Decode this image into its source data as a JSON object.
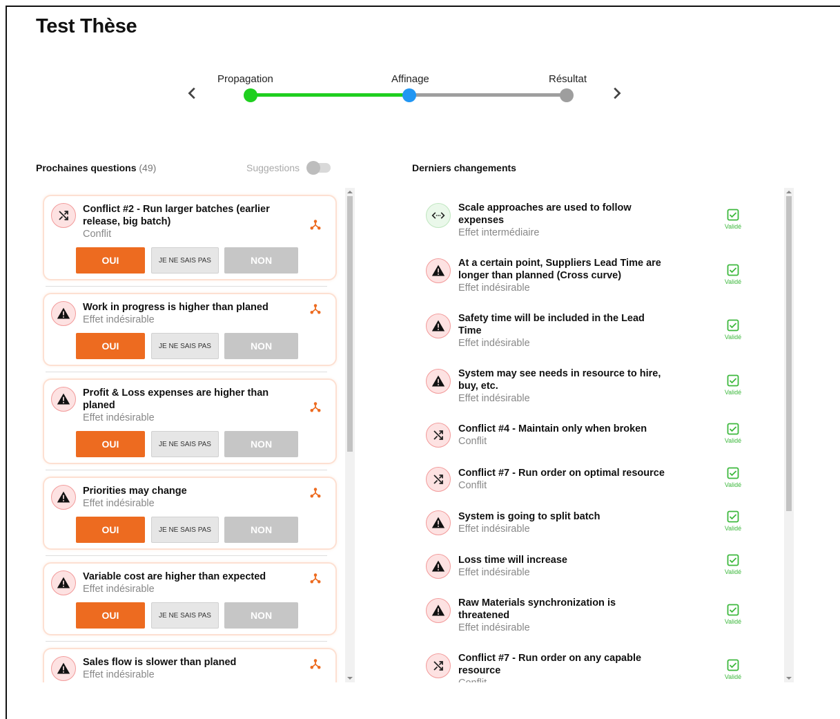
{
  "page": {
    "title": "Test Thèse"
  },
  "stepper": {
    "steps": [
      {
        "label": "Propagation",
        "state": "done",
        "color": "#1fcf1f"
      },
      {
        "label": "Affinage",
        "state": "current",
        "color": "#2196f3"
      },
      {
        "label": "Résultat",
        "state": "pending",
        "color": "#9e9e9e"
      }
    ],
    "prev_icon": "chevron-left-icon",
    "next_icon": "chevron-right-icon"
  },
  "questions_panel": {
    "title": "Prochaines questions",
    "count": "(49)",
    "suggestions_label": "Suggestions",
    "suggestions_enabled": false,
    "buttons": {
      "yes": "OUI",
      "unknown": "JE NE SAIS PAS",
      "no": "NON"
    },
    "items": [
      {
        "title": "Conflict #2 - Run larger batches (earlier release, big batch)",
        "type": "Conflit",
        "icon": "shuffle-icon"
      },
      {
        "title": "Work in progress is higher than planed",
        "type": "Effet indésirable",
        "icon": "warning-icon"
      },
      {
        "title": "Profit & Loss expenses are higher than planed",
        "type": "Effet indésirable",
        "icon": "warning-icon"
      },
      {
        "title": "Priorities may change",
        "type": "Effet indésirable",
        "icon": "warning-icon"
      },
      {
        "title": "Variable cost are higher than expected",
        "type": "Effet indésirable",
        "icon": "warning-icon"
      },
      {
        "title": "Sales flow is slower than planed",
        "type": "Effet indésirable",
        "icon": "warning-icon"
      }
    ]
  },
  "changes_panel": {
    "title": "Derniers changements",
    "status_label": "Validé",
    "items": [
      {
        "title": "Scale approaches are used to follow expenses",
        "type": "Effet intermédiaire",
        "icon": "arrows-horizontal-icon"
      },
      {
        "title": "At a certain point, Suppliers Lead Time are longer than planned (Cross curve)",
        "type": "Effet indésirable",
        "icon": "warning-icon"
      },
      {
        "title": "Safety time will be included in the Lead Time",
        "type": "Effet indésirable",
        "icon": "warning-icon"
      },
      {
        "title": "System may see needs in resource to hire, buy, etc.",
        "type": "Effet indésirable",
        "icon": "warning-icon"
      },
      {
        "title": "Conflict #4 - Maintain only when broken",
        "type": "Conflit",
        "icon": "shuffle-icon"
      },
      {
        "title": "Conflict #7 - Run order on optimal resource",
        "type": "Conflit",
        "icon": "shuffle-icon"
      },
      {
        "title": "System is going to split batch",
        "type": "Effet indésirable",
        "icon": "warning-icon"
      },
      {
        "title": "Loss time will increase",
        "type": "Effet indésirable",
        "icon": "warning-icon"
      },
      {
        "title": "Raw Materials synchronization is threatened",
        "type": "Effet indésirable",
        "icon": "warning-icon"
      },
      {
        "title": "Conflict #7 - Run order on any capable resource",
        "type": "Conflit",
        "icon": "shuffle-icon"
      }
    ]
  }
}
